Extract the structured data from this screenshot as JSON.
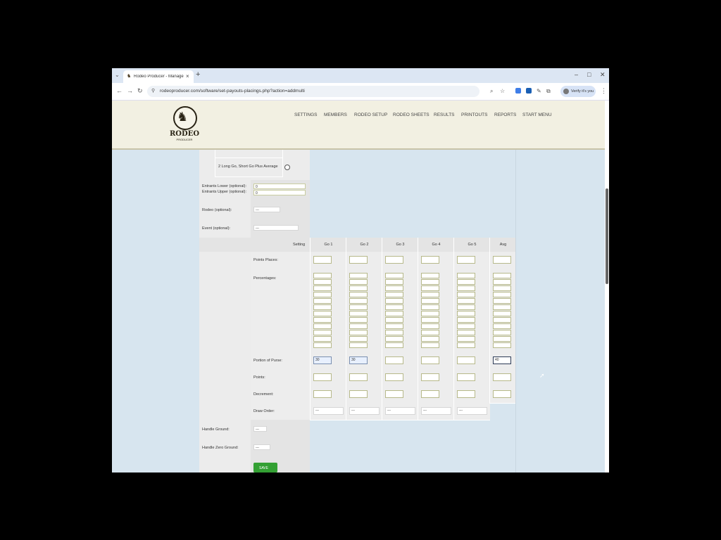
{
  "browser": {
    "tab_title": "Rodeo Producer - Manage Pay",
    "tab_close": "×",
    "new_tab": "+",
    "url": "rodeoproducer.com/software/set-payouts-placings.php?action=addmulti",
    "verify_label": "Verify it's you",
    "window_controls": [
      "–",
      "□",
      "✕"
    ]
  },
  "site": {
    "logo_text": "RODEO",
    "logo_sub": "PRODUCER",
    "nav": [
      "SETTINGS",
      "MEMBERS",
      "RODEO SETUP",
      "RODEO SHEETS",
      "RESULTS",
      "PRINTOUTS",
      "REPORTS",
      "START MENU"
    ]
  },
  "form": {
    "option_row_label": "2 Long Go, Short Go Plus Average",
    "entrants_lower_label": "Entrants Lower (optional):",
    "entrants_upper_label": "Entrants Upper (optional):",
    "entrants_lower_value": "0",
    "entrants_upper_value": "0",
    "rodeo_label": "Rodeo (optional):",
    "rodeo_value": "---",
    "event_label": "Event (optional):",
    "event_value": "---",
    "setting_header": "Setting",
    "go_headers": [
      "Go 1",
      "Go 2",
      "Go 3",
      "Go 4",
      "Go 5",
      "Avg"
    ],
    "points_places_label": "Points Places:",
    "percentages_label": "Percentages:",
    "portion_of_purse_label": "Portion of Purse:",
    "portion_values": [
      "30",
      "30",
      "",
      "",
      "",
      "40"
    ],
    "points_label": "Points:",
    "decrement_label": "Decrement:",
    "draw_order_label": "Draw Order:",
    "draw_order_values": [
      "---",
      "---",
      "---",
      "---",
      "---"
    ],
    "handle_ground_label": "Handle Ground:",
    "handle_ground_value": "---",
    "handle_zero_ground_label": "Handle Zero Ground:",
    "handle_zero_ground_value": "---",
    "save_label": "SAVE"
  },
  "colors": {
    "header_bg": "#f2f0e2",
    "page_bg": "#d7e5ef",
    "save_green": "#33a033"
  }
}
